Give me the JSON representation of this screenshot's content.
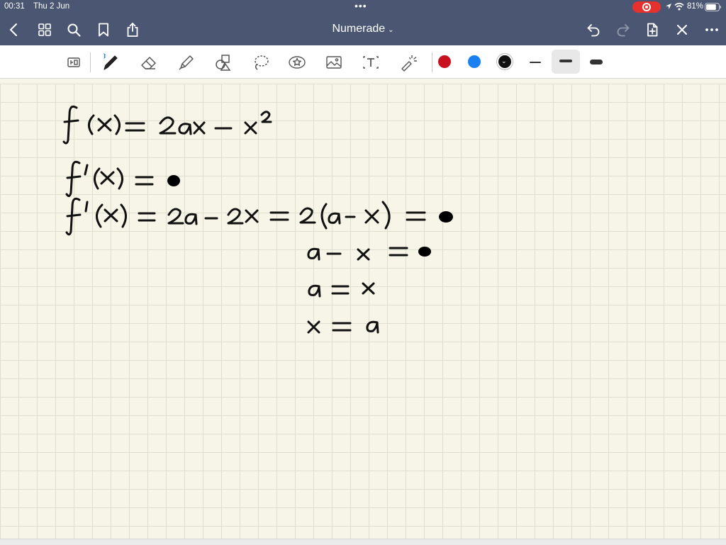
{
  "status_bar": {
    "time": "00:31",
    "date": "Thu 2 Jun",
    "battery_percent": "81%",
    "battery_level": 0.81
  },
  "nav_bar": {
    "document_title": "Numerade",
    "title_caret": "⌄"
  },
  "toolbar": {
    "colors": [
      "#c8101e",
      "#1a7ff0",
      "#111111"
    ],
    "selected_color_index": 2,
    "stroke_widths": [
      "thin",
      "medium",
      "thick"
    ],
    "selected_stroke_index": 1
  },
  "theme": {
    "bar_color": "#4b5673",
    "paper_color": "#f6f5e7",
    "grid_color": "#dde0cf"
  }
}
